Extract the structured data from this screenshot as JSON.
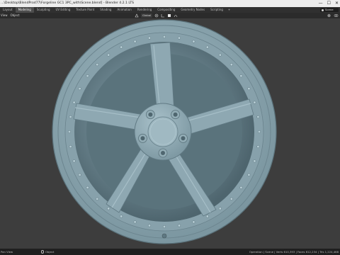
{
  "window": {
    "title": "...\\Desktop\\BlendProd77\\Forgeline GC1 3PC_with\\Scene.blend] - Blender 4.2.1 LTS",
    "minimize_glyph": "—",
    "maximize_glyph": "☐",
    "close_glyph": "✕"
  },
  "workspace_tabs": [
    "Layout",
    "Modeling",
    "Sculpting",
    "UV Editing",
    "Texture Paint",
    "Shading",
    "Animation",
    "Rendering",
    "Compositing",
    "Geometry Nodes",
    "Scripting"
  ],
  "active_tab": "Modeling",
  "add_tab_glyph": "+",
  "scene_selector": {
    "label": "Scene"
  },
  "header": {
    "menu": [
      "View",
      "Object"
    ],
    "orientation": "Global",
    "icons": [
      "transform-pivot-icon",
      "snap-icon",
      "proportional-editing-icon",
      "viewport-shading-icon"
    ]
  },
  "status": {
    "left": "Pan View",
    "middle": "Object",
    "right": "Operation | Scene | Verts 610,393 | Faces 612,234 | Tris 1,224,468"
  },
  "colors": {
    "wheel": "#8fa8b1",
    "wheel_dark": "#5f7882",
    "background": "#3d3d3d",
    "accent_active_tab": "#4d4d4d"
  }
}
